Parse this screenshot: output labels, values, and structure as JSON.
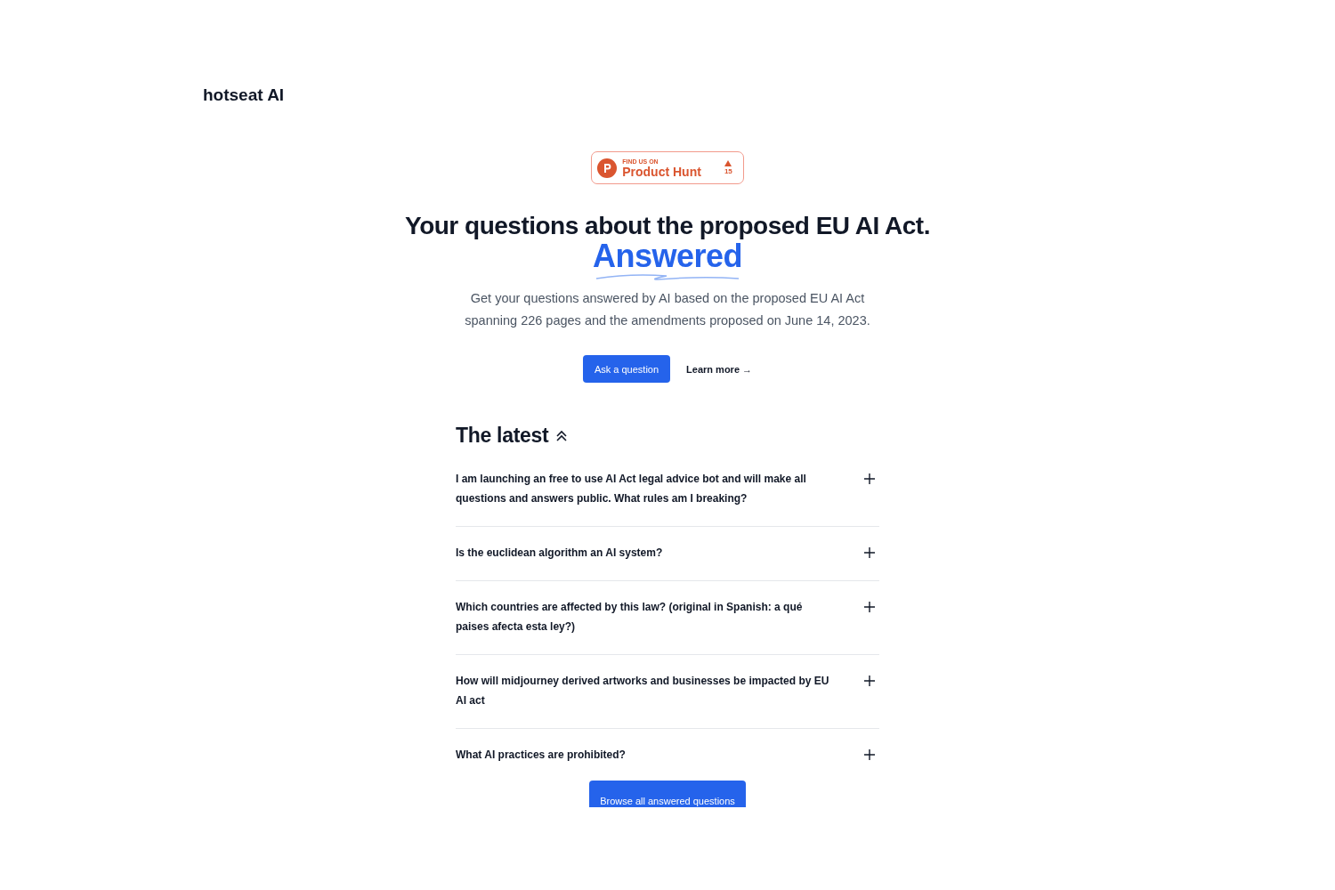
{
  "logo": "hotseat AI",
  "badge": {
    "eyebrow": "FIND US ON",
    "name": "Product Hunt",
    "votes": "15"
  },
  "hero": {
    "title": "Your questions about the proposed EU AI Act.",
    "highlight": "Answered",
    "subtitle": "Get your questions answered by AI based on the proposed EU AI Act spanning 226 pages and the amendments proposed on June 14, 2023.",
    "primary_button": "Ask a question",
    "link": "Learn more →"
  },
  "latest": {
    "heading": "The latest",
    "questions": [
      {
        "text": "I am launching an free to use AI Act legal advice bot and will make all questions and answers public. What rules am I breaking?",
        "expanded": false
      },
      {
        "text": "Is the euclidean algorithm an AI system?",
        "expanded": false
      },
      {
        "text": "Which countries are affected by this law? (original in Spanish: a qué paises afecta esta ley?)",
        "expanded": false
      },
      {
        "text": "How will midjourney derived artworks and businesses be impacted by EU AI act",
        "expanded": false
      },
      {
        "text": "What AI practices are prohibited?",
        "expanded": false
      }
    ],
    "browse_button": "Browse all answered questions"
  }
}
